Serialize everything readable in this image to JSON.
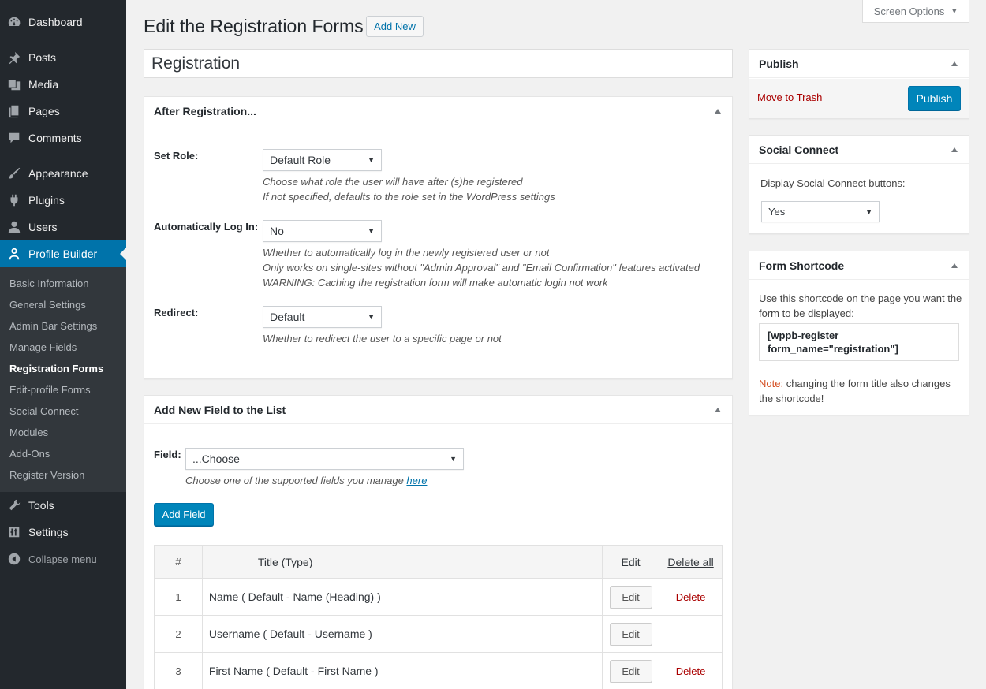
{
  "sidebar": {
    "items": [
      {
        "label": "Dashboard",
        "icon": "dashboard-icon"
      },
      {
        "label": "Posts",
        "icon": "pin-icon"
      },
      {
        "label": "Media",
        "icon": "media-icon"
      },
      {
        "label": "Pages",
        "icon": "pages-icon"
      },
      {
        "label": "Comments",
        "icon": "comment-icon"
      },
      {
        "label": "Appearance",
        "icon": "brush-icon"
      },
      {
        "label": "Plugins",
        "icon": "plug-icon"
      },
      {
        "label": "Users",
        "icon": "user-icon"
      },
      {
        "label": "Profile Builder",
        "icon": "profile-icon"
      },
      {
        "label": "Tools",
        "icon": "wrench-icon"
      },
      {
        "label": "Settings",
        "icon": "settings-icon"
      }
    ],
    "submenu": [
      "Basic Information",
      "General Settings",
      "Admin Bar Settings",
      "Manage Fields",
      "Registration Forms",
      "Edit-profile Forms",
      "Social Connect",
      "Modules",
      "Add-Ons",
      "Register Version"
    ],
    "collapse_label": "Collapse menu"
  },
  "header": {
    "title": "Edit the Registration Forms",
    "add_new": "Add New",
    "screen_options": "Screen Options"
  },
  "form_title": "Registration",
  "after_registration": {
    "heading": "After Registration...",
    "set_role": {
      "label": "Set Role:",
      "value": "Default Role",
      "desc1": "Choose what role the user will have after (s)he registered",
      "desc2": "If not specified, defaults to the role set in the WordPress settings"
    },
    "auto_login": {
      "label": "Automatically Log In:",
      "value": "No",
      "desc1": "Whether to automatically log in the newly registered user or not",
      "desc2": "Only works on single-sites without \"Admin Approval\" and \"Email Confirmation\" features activated",
      "desc3": "WARNING: Caching the registration form will make automatic login not work"
    },
    "redirect": {
      "label": "Redirect:",
      "value": "Default",
      "desc1": "Whether to redirect the user to a specific page or not"
    }
  },
  "add_field": {
    "heading": "Add New Field to the List",
    "field_label": "Field:",
    "field_value": "...Choose",
    "desc": "Choose one of the supported fields you manage ",
    "desc_link": "here",
    "button": "Add Field"
  },
  "fields_table": {
    "columns": [
      "#",
      "Title (Type)",
      "Edit",
      "Delete all"
    ],
    "rows": [
      {
        "num": "1",
        "title": "Name ( Default - Name (Heading) )",
        "edit": "Edit",
        "delete": "Delete"
      },
      {
        "num": "2",
        "title": "Username ( Default - Username )",
        "edit": "Edit",
        "delete": ""
      },
      {
        "num": "3",
        "title": "First Name ( Default - First Name )",
        "edit": "Edit",
        "delete": "Delete"
      }
    ]
  },
  "publish": {
    "heading": "Publish",
    "trash": "Move to Trash",
    "button": "Publish"
  },
  "social_connect": {
    "heading": "Social Connect",
    "label": "Display Social Connect buttons:",
    "value": "Yes"
  },
  "shortcode": {
    "heading": "Form Shortcode",
    "desc": "Use this shortcode on the page you want the form to be displayed:",
    "code_line1": "[wppb-register",
    "code_line2": "form_name=\"registration\"]",
    "note_label": "Note:",
    "note_text": " changing the form title also changes the shortcode!"
  },
  "colors": {
    "sidebar_bg": "#23282d",
    "submenu_bg": "#32373c",
    "accent": "#0073aa",
    "primary_button": "#0085ba",
    "danger": "#a00"
  }
}
